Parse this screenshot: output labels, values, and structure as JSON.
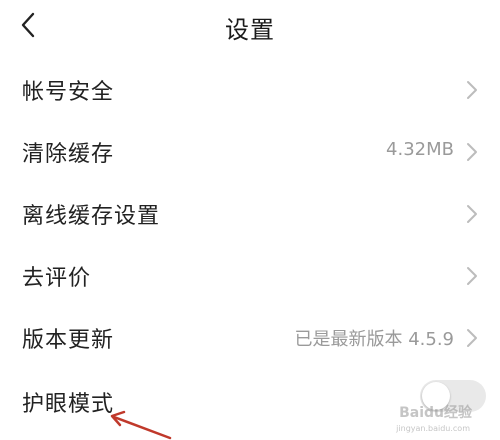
{
  "header": {
    "title": "设置",
    "back_icon": "chevron-left-icon"
  },
  "settings": [
    {
      "label": "帐号安全",
      "value": "",
      "accessory": "chevron-right-icon"
    },
    {
      "label": "清除缓存",
      "value": "4.32MB",
      "accessory": "chevron-right-icon"
    },
    {
      "label": "离线缓存设置",
      "value": "",
      "accessory": "chevron-right-icon"
    },
    {
      "label": "去评价",
      "value": "",
      "accessory": "chevron-right-icon"
    },
    {
      "label": "版本更新",
      "value": "已是最新版本 4.5.9",
      "accessory": "chevron-right-icon"
    },
    {
      "label": "护眼模式",
      "value": "",
      "accessory": "toggle-switch",
      "toggle_on": false
    }
  ],
  "watermark": {
    "text": "Baidu经验",
    "subtext": "jingyan.baidu.com"
  },
  "colors": {
    "text": "#222222",
    "secondary": "#9a9a9a",
    "chevron": "#bcbcbc",
    "arrow": "#c0392b"
  }
}
